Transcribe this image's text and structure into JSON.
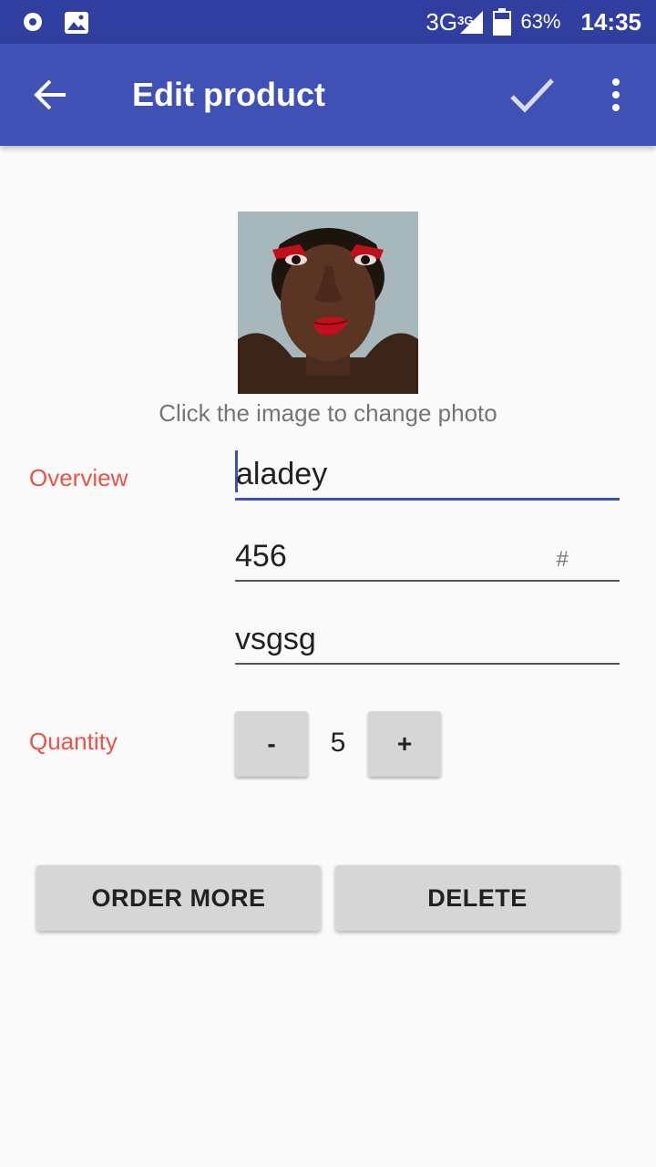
{
  "status_bar": {
    "network": "3G",
    "network_small": "3G",
    "battery": "63%",
    "time": "14:35"
  },
  "app_bar": {
    "title": "Edit product"
  },
  "photo": {
    "hint": "Click the image to change photo"
  },
  "overview": {
    "label": "Overview",
    "name_value": "aladey",
    "price_value": "456",
    "price_suffix": "#",
    "supplier_value": "vsgsg"
  },
  "quantity": {
    "label": "Quantity",
    "minus_label": "-",
    "value": "5",
    "plus_label": "+"
  },
  "actions": {
    "order_more_label": "ORDER MORE",
    "delete_label": "DELETE"
  },
  "colors": {
    "status_bar": "#303f9f",
    "app_bar": "#3f51b5",
    "label_accent": "#e8534a"
  }
}
